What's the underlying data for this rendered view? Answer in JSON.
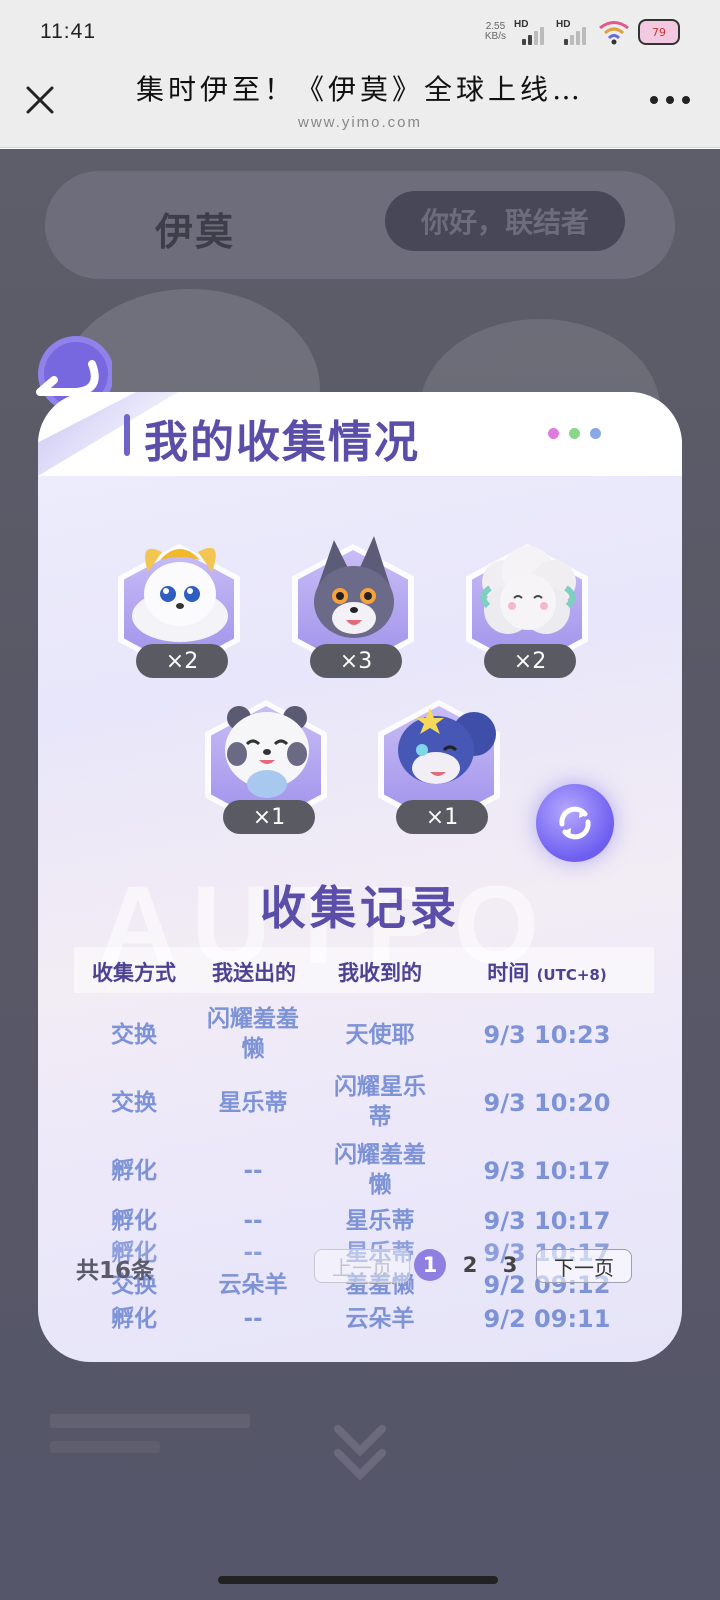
{
  "status_bar": {
    "time": "11:41",
    "net_speed_value": "2.55",
    "net_speed_unit": "KB/s",
    "hd_label_1": "HD",
    "hd_label_2": "HD",
    "battery": "79"
  },
  "nav": {
    "title": "集时伊至！《伊莫》全球上线…",
    "url": "www.yimo.com",
    "close_icon": "close-icon",
    "more_icon": "more-icon"
  },
  "background_page": {
    "logo": "伊莫",
    "greeting": "你好，联结者"
  },
  "modal": {
    "title": "我的收集情况",
    "dots_colors": [
      "#e07ae0",
      "#8ad68a",
      "#8aa8e8"
    ],
    "accent": "#5b4ea8",
    "watermark": "AUTPO",
    "collection": [
      {
        "name": "creature-cream-fox",
        "count": "×2",
        "color": "#f3c653"
      },
      {
        "name": "creature-gray-fox",
        "count": "×3",
        "color": "#5d5c78"
      },
      {
        "name": "creature-cloud-sheep",
        "count": "×2",
        "color": "#e8e6ea"
      },
      {
        "name": "creature-white-bear",
        "count": "×1",
        "color": "#f2f2f4"
      },
      {
        "name": "creature-blue-squirrel",
        "count": "×1",
        "color": "#3f4ea8"
      }
    ],
    "records_title": "收集记录",
    "table": {
      "headers": [
        "收集方式",
        "我送出的",
        "我收到的",
        "时间"
      ],
      "time_suffix": "(UTC+8)",
      "rows": [
        {
          "method": "交换",
          "sent": "闪耀羞羞懒",
          "received": "天使耶",
          "time": "9/3 10:23"
        },
        {
          "method": "交换",
          "sent": "星乐蒂",
          "received": "闪耀星乐蒂",
          "time": "9/3 10:20"
        },
        {
          "method": "孵化",
          "sent": "--",
          "received": "闪耀羞羞懒",
          "time": "9/3 10:17"
        },
        {
          "method": "孵化",
          "sent": "--",
          "received": "星乐蒂",
          "time": "9/3 10:17"
        },
        {
          "method": "孵化",
          "sent": "--",
          "received": "星乐蒂",
          "time": "9/3 10:17"
        },
        {
          "method": "交换",
          "sent": "云朵羊",
          "received": "羞羞懒",
          "time": "9/2 09:12"
        },
        {
          "method": "孵化",
          "sent": "--",
          "received": "云朵羊",
          "time": "9/2 09:11"
        }
      ]
    },
    "pagination": {
      "total": "共16条",
      "prev": "上一页",
      "pages": [
        "1",
        "2",
        "3"
      ],
      "current": "1",
      "next": "下一页"
    }
  }
}
